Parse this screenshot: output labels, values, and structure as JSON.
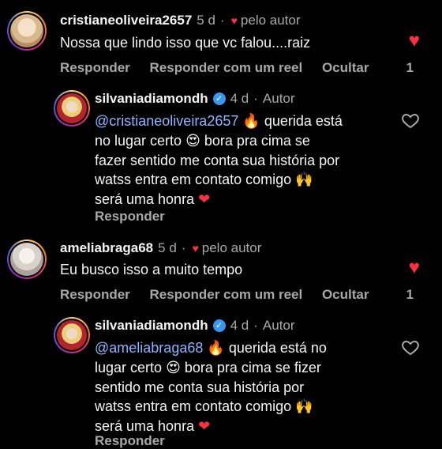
{
  "comments": [
    {
      "username": "cristianeoliveira2657",
      "time": "5 d",
      "author_label": "pelo autor",
      "text": "Nossa que lindo isso que vc falou....raiz",
      "actions": [
        "Responder",
        "Responder com um reel",
        "Ocultar"
      ],
      "likes": "1",
      "reply": {
        "username": "silvaniadiamondh",
        "time": "4 d",
        "role": "Autor",
        "mention": "@cristianeoliveira2657",
        "text_lines": [
          "querida está",
          "no lugar certo",
          "bora pra cima se",
          "fazer sentido me conta sua história por",
          "watss entra em contato comigo",
          "será uma honra"
        ],
        "action": "Responder"
      }
    },
    {
      "username": "ameliabraga68",
      "time": "5 d",
      "author_label": "pelo autor",
      "text": "Eu busco isso a muito tempo",
      "actions": [
        "Responder",
        "Responder com um reel",
        "Ocultar"
      ],
      "likes": "1",
      "reply": {
        "username": "silvaniadiamondh",
        "time": "4 d",
        "role": "Autor",
        "mention": "@ameliabraga68",
        "text_lines": [
          "querida está no",
          "lugar certo",
          "bora pra cima se fizer",
          "sentido me conta sua história por",
          "watss entra em contato comigo",
          "será uma honra"
        ],
        "action": "Responder"
      }
    }
  ],
  "icons": {
    "heart_filled": "♥",
    "verified": "✓",
    "fire": "🔥",
    "smile": "😍",
    "raised_hands": "🙌",
    "red_heart": "❤"
  }
}
